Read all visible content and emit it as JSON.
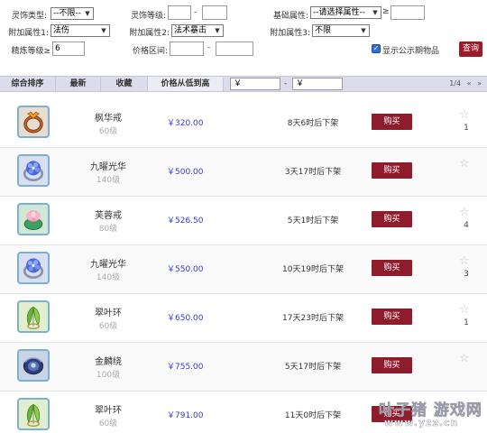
{
  "filters": {
    "type_label": "灵饰类型:",
    "type_value": "--不限--",
    "level_label": "灵饰等级:",
    "level_dash": "-",
    "base_attr_label": "基础属性:",
    "base_attr_value": "--请选择属性--",
    "base_attr_cmp": "≥",
    "attr1_label": "附加属性1:",
    "attr1_value": "法伤",
    "attr2_label": "附加属性2:",
    "attr2_value": "法术暴击",
    "attr3_label": "附加属性3:",
    "attr3_value": "不限",
    "refine_label": "精炼等级≥",
    "refine_value": "6",
    "price_label": "价格区间:",
    "price_dash": "-",
    "show_public_label": "显示公示期物品",
    "query_label": "查询"
  },
  "sortbar": {
    "tabs": [
      "综合排序",
      "最新",
      "收藏",
      "价格从低到高"
    ],
    "active_index": 3,
    "price_min_placeholder": "￥",
    "price_dash": "-",
    "price_max_placeholder": "￥",
    "page": "1/4",
    "prev_icon": "«",
    "next_icon": "»"
  },
  "items": [
    {
      "name": "枫华戒",
      "level": "60级",
      "price": "￥320.00",
      "time": "8天6时后下架",
      "buy": "购买",
      "favorites": "1",
      "icon": "ring-orange-icon"
    },
    {
      "name": "九曜光华",
      "level": "140级",
      "price": "￥500.00",
      "time": "3天17时后下架",
      "buy": "购买",
      "favorites": "",
      "icon": "ring-blue-flower-icon"
    },
    {
      "name": "芙蓉戒",
      "level": "80级",
      "price": "￥526.50",
      "time": "5天1时后下架",
      "buy": "购买",
      "favorites": "4",
      "icon": "ring-lotus-icon"
    },
    {
      "name": "九曜光华",
      "level": "140级",
      "price": "￥550.00",
      "time": "10天19时后下架",
      "buy": "购买",
      "favorites": "3",
      "icon": "ring-blue-flower-icon"
    },
    {
      "name": "翠叶环",
      "level": "60级",
      "price": "￥650.00",
      "time": "17天23时后下架",
      "buy": "购买",
      "favorites": "1",
      "icon": "ring-leaf-icon"
    },
    {
      "name": "金麟绕",
      "level": "100级",
      "price": "￥755.00",
      "time": "5天17时后下架",
      "buy": "购买",
      "favorites": "",
      "icon": "ring-dragon-icon"
    },
    {
      "name": "翠叶环",
      "level": "60级",
      "price": "￥791.00",
      "time": "11天0时后下架",
      "buy": "购买",
      "favorites": "",
      "icon": "ring-leaf-icon"
    }
  ],
  "watermark": {
    "top": "叶子猪 游戏网",
    "bottom": "www.yzz.cn"
  }
}
